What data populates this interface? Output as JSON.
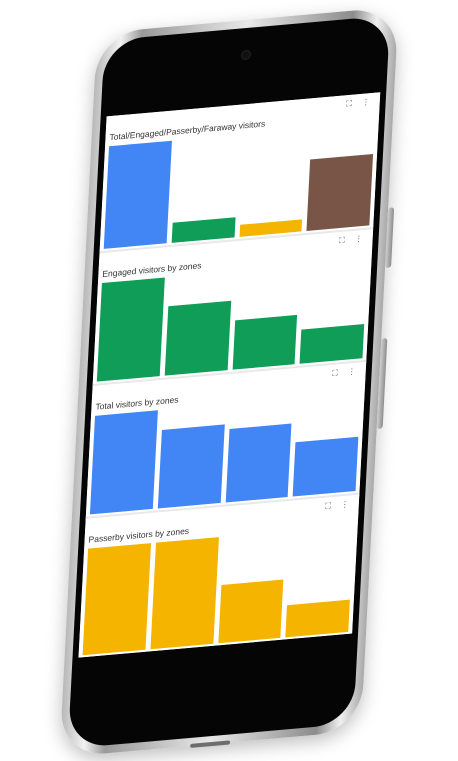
{
  "charts": [
    {
      "title": "Total/Engaged/Passerby/Faraway visitors",
      "chart_data": {
        "type": "bar",
        "values": [
          100,
          20,
          12,
          70
        ],
        "colors": [
          "#4285f4",
          "#0f9d58",
          "#f4b400",
          "#795548"
        ]
      }
    },
    {
      "title": "Engaged visitors by zones",
      "chart_data": {
        "type": "bar",
        "values": [
          100,
          70,
          50,
          35
        ],
        "colors": [
          "#0f9d58",
          "#0f9d58",
          "#0f9d58",
          "#0f9d58"
        ]
      }
    },
    {
      "title": "Total visitors by zones",
      "chart_data": {
        "type": "bar",
        "values": [
          100,
          80,
          75,
          55
        ],
        "colors": [
          "#4285f4",
          "#4285f4",
          "#4285f4",
          "#4285f4"
        ]
      }
    },
    {
      "title": "Passerby visitors by zones",
      "chart_data": {
        "type": "bar",
        "values": [
          100,
          100,
          55,
          30
        ],
        "colors": [
          "#f4b400",
          "#f4b400",
          "#f4b400",
          "#f4b400"
        ]
      }
    }
  ],
  "icons": {
    "expand": "expand-icon",
    "more": "more-vert-icon"
  }
}
